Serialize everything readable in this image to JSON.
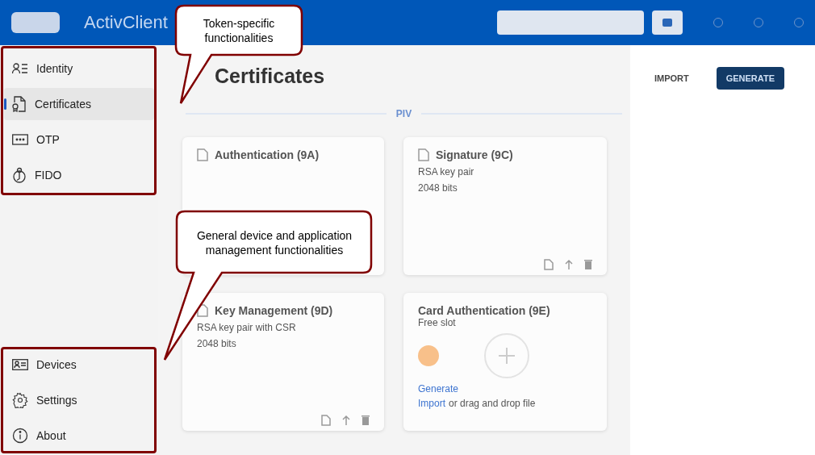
{
  "window": {
    "title": "ActivClient"
  },
  "sidebar": {
    "top_items": [
      {
        "label": "Identity",
        "selected": false
      },
      {
        "label": "Certificates",
        "selected": true
      },
      {
        "label": "OTP",
        "selected": false
      },
      {
        "label": "FIDO",
        "selected": false
      }
    ],
    "bottom_items": [
      {
        "label": "Devices",
        "selected": false
      },
      {
        "label": "Settings",
        "selected": false
      },
      {
        "label": "About",
        "selected": false
      }
    ]
  },
  "page": {
    "title": "Certificates",
    "tabs": [
      {
        "label": "PIV",
        "selected": true
      }
    ],
    "buttons": [
      {
        "label": "IMPORT",
        "kind": "text"
      },
      {
        "label": "GENERATE",
        "kind": "primary"
      }
    ],
    "cards": [
      {
        "kind": "certificate",
        "title": "Authentication (9A)"
      },
      {
        "kind": "certificate",
        "title": "Signature (9C)",
        "lines": [
          "RSA key pair",
          "2048 bits"
        ]
      },
      {
        "kind": "certificate",
        "title": "Key Management (9D)",
        "lines": [
          "RSA key pair with CSR",
          "2048 bits"
        ]
      },
      {
        "kind": "empty",
        "title": "Card Authentication (9E)",
        "status": "Free slot",
        "generate_link": "Generate",
        "import_link": "Import",
        "import_text": "or drag and drop file"
      }
    ]
  },
  "callouts": [
    {
      "text": "Token-specific functionalities"
    },
    {
      "text": "General device and application management functionalities"
    }
  ]
}
